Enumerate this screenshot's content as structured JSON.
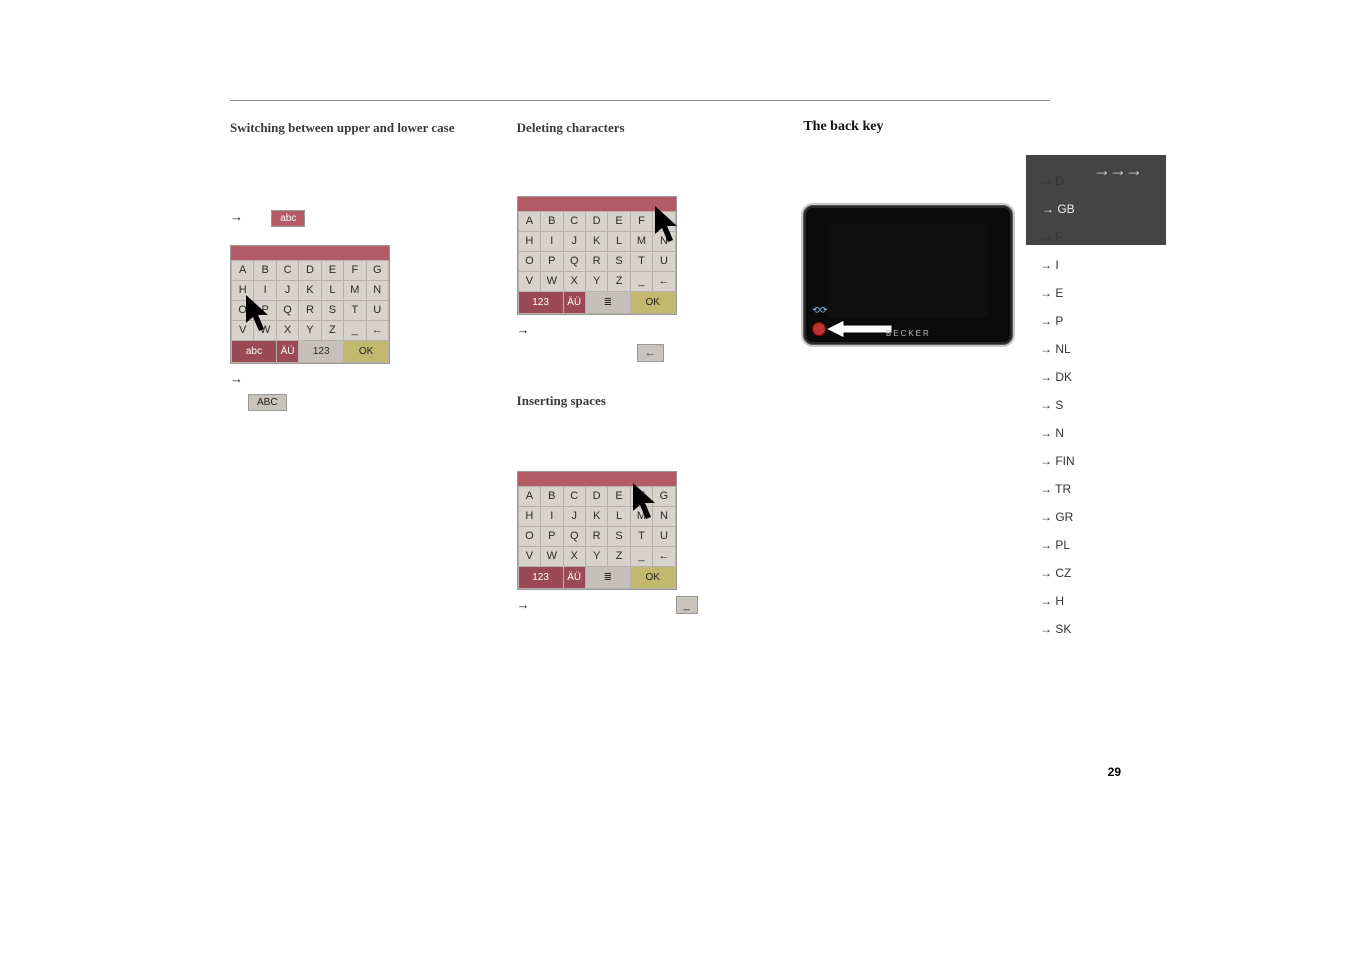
{
  "headings": {
    "col1": "Switching between upper and lower case",
    "col2a": "Deleting characters",
    "col2b": "Inserting spaces",
    "col3": "The back key"
  },
  "inline": {
    "abc_btn": "abc",
    "ABC_btn": "ABC",
    "back_arrow": "←",
    "space": "_"
  },
  "keypad": {
    "rows": [
      [
        "A",
        "B",
        "C",
        "D",
        "E",
        "F",
        "G"
      ],
      [
        "H",
        "I",
        "J",
        "K",
        "L",
        "M",
        "N"
      ],
      [
        "O",
        "P",
        "Q",
        "R",
        "S",
        "T",
        "U"
      ],
      [
        "V",
        "W",
        "X",
        "Y",
        "Z",
        "_",
        "←"
      ]
    ],
    "fn_a": [
      "abc",
      "ÄÜ",
      "123",
      "OK"
    ],
    "fn_b": [
      "123",
      "ÄÜ",
      "≣",
      "OK"
    ]
  },
  "device": {
    "brand": "BECKER"
  },
  "nav": {
    "items": [
      "D",
      "GB",
      "F",
      "I",
      "E",
      "P",
      "NL",
      "DK",
      "S",
      "N",
      "FIN",
      "TR",
      "GR",
      "PL",
      "CZ",
      "H",
      "SK"
    ],
    "active": "GB"
  },
  "page_number": "29"
}
